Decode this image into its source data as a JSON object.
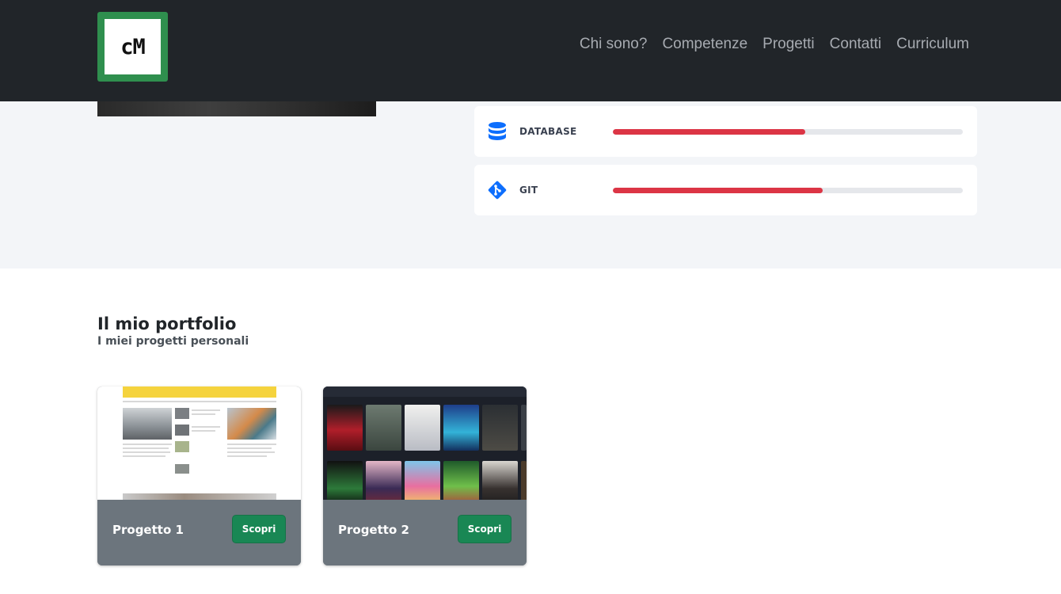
{
  "navbar": {
    "logo_text": "cM",
    "links": [
      "Chi sono?",
      "Competenze",
      "Progetti",
      "Contatti",
      "Curriculum"
    ]
  },
  "skills": [
    {
      "name": "DATABASE",
      "icon": "database-icon",
      "level": 0.55
    },
    {
      "name": "GIT",
      "icon": "git-icon",
      "level": 0.6
    }
  ],
  "colors": {
    "navbar": "#212529",
    "accent_bar": "#dc3545",
    "button": "#198754",
    "icon_blue": "#0d6efd"
  },
  "portfolio": {
    "title": "Il mio portfolio",
    "subtitle": "I miei progetti personali",
    "projects": [
      {
        "title": "Progetto 1",
        "button": "Scopri"
      },
      {
        "title": "Progetto 2",
        "button": "Scopri"
      }
    ]
  }
}
